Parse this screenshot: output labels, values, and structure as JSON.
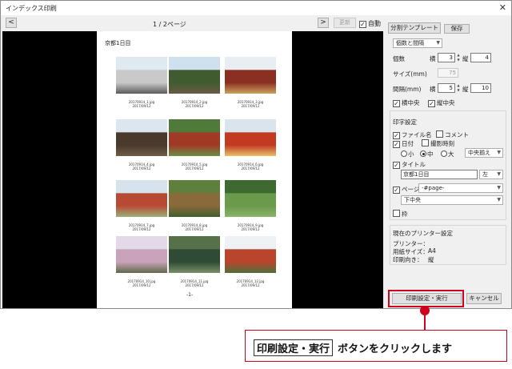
{
  "window": {
    "title": "インデックス印刷",
    "close_icon": "close-icon"
  },
  "toolbar": {
    "prev": "<",
    "next": ">",
    "page_label": "1 / 2ページ",
    "update_label": "更新",
    "auto_label": "自動",
    "auto_checked": true
  },
  "paper": {
    "title": "京都1日目",
    "page_number": "-1-",
    "photos": [
      {
        "name": "20170914_1.jpg",
        "date": "2017/09/12",
        "colors": [
          "#dfe9f0",
          "#c9c9c9",
          "#5b5b5b"
        ]
      },
      {
        "name": "20170914_2.jpg",
        "date": "2017/09/12",
        "colors": [
          "#cfe0ef",
          "#3f5b2f",
          "#6b5a45"
        ]
      },
      {
        "name": "20170914_3.jpg",
        "date": "2017/09/12",
        "colors": [
          "#e9eef2",
          "#8b2f22",
          "#c9a35b"
        ]
      },
      {
        "name": "20170914_4.jpg",
        "date": "2017/09/12",
        "colors": [
          "#dbe6ee",
          "#4a3a2e",
          "#6f5b46"
        ]
      },
      {
        "name": "20170914_5.jpg",
        "date": "2017/09/12",
        "colors": [
          "#4f7a3a",
          "#a13a25",
          "#6a8f4a"
        ]
      },
      {
        "name": "20170914_6.jpg",
        "date": "2017/09/12",
        "colors": [
          "#d9e4ec",
          "#c23a22",
          "#e8c06a"
        ]
      },
      {
        "name": "20170914_7.jpg",
        "date": "2017/09/12",
        "colors": [
          "#d7e3ec",
          "#b84a33",
          "#9bb07a"
        ]
      },
      {
        "name": "20170914_8.jpg",
        "date": "2017/09/12",
        "colors": [
          "#5f7f3c",
          "#8a6a3b",
          "#3f5f2a"
        ]
      },
      {
        "name": "20170914_9.jpg",
        "date": "2017/09/12",
        "colors": [
          "#3f6a2f",
          "#6c9a4c",
          "#8ab56a"
        ]
      },
      {
        "name": "20170914_10.jpg",
        "date": "2017/09/12",
        "colors": [
          "#e3d9e8",
          "#c9a3b9",
          "#5f6a4a"
        ]
      },
      {
        "name": "20170914_11.jpg",
        "date": "2017/09/12",
        "colors": [
          "#56704a",
          "#2f4a35",
          "#7a8f6a"
        ]
      },
      {
        "name": "20170914_12.jpg",
        "date": "2017/09/12",
        "colors": [
          "#eef2f5",
          "#b8452c",
          "#4f6f3a"
        ]
      }
    ]
  },
  "panel": {
    "template_button": "分割テンプレート",
    "save_button": "保存",
    "mode_select": "個数と間隔",
    "count_label": "個数",
    "yoko_label": "横",
    "tate_label": "縦",
    "count_h": "3",
    "count_v": "4",
    "size_label": "サイズ(mm)",
    "size_value": "75",
    "gap_label": "間隔(mm)",
    "gap_h": "5",
    "gap_v": "10",
    "center_h_label": "横中央",
    "center_v_label": "縦中央",
    "print_settings_label": "印字設定",
    "filename_label": "ファイル名",
    "comment_label": "コメント",
    "date_label": "日付",
    "shoot_time_label": "撮影時刻",
    "size_small": "小",
    "size_medium": "中",
    "size_large": "大",
    "align_select": "中央揃え",
    "title_label": "タイトル",
    "title_value": "京都1日目",
    "title_pos": "左",
    "page_label": "ページ",
    "page_format": "-#page-",
    "page_pos": "下中央",
    "frame_label": "枠",
    "printer_group_label": "現在のプリンター設定",
    "printer_label": "プリンター：",
    "paper_size_label": "用紙サイズ：",
    "paper_size_value": "A4",
    "orientation_label": "印刷向き：",
    "orientation_value": "縦",
    "print_button": "印刷設定・実行",
    "cancel_button": "キャンセル"
  },
  "callout": {
    "key": "印刷設定・実行",
    "text": "ボタンをクリックします",
    "accent": "#d0021b"
  }
}
